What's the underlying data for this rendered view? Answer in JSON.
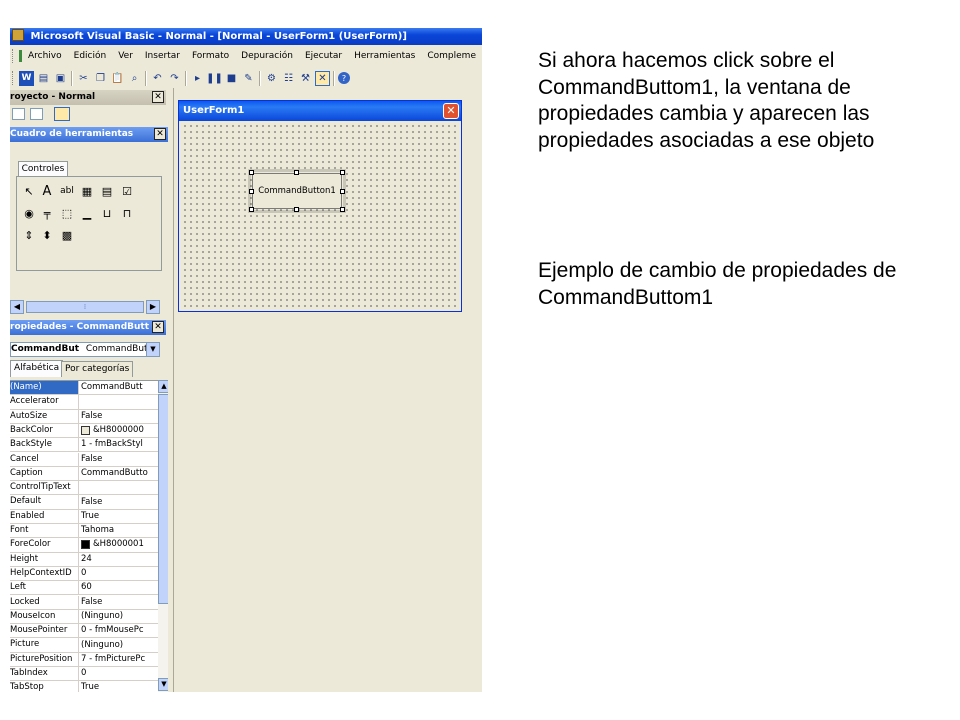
{
  "window": {
    "title": "Microsoft Visual Basic - Normal - [Normal - UserForm1 (UserForm)]"
  },
  "menu": [
    "Archivo",
    "Edición",
    "Ver",
    "Insertar",
    "Formato",
    "Depuración",
    "Ejecutar",
    "Herramientas",
    "Compleme"
  ],
  "project_pane": {
    "title": "royecto - Normal"
  },
  "toolbox": {
    "title": "Cuadro de herramientas",
    "tab": "Controles",
    "label_tool": "A",
    "textbox_tool": "abl"
  },
  "userform": {
    "title": "UserForm1",
    "button_label": "CommandButton1",
    "close_glyph": "✕"
  },
  "properties": {
    "title": "ropiedades - CommandButt",
    "object_name": "CommandBut",
    "object_type": "CommandButto",
    "tabs": [
      "Alfabética",
      "Por categorías"
    ],
    "rows": [
      {
        "name": "(Name)",
        "value": "CommandButt"
      },
      {
        "name": "Accelerator",
        "value": ""
      },
      {
        "name": "AutoSize",
        "value": "False"
      },
      {
        "name": "BackColor",
        "value": "&H8000000",
        "swatch": "#ece9d8"
      },
      {
        "name": "BackStyle",
        "value": "1 - fmBackStyl"
      },
      {
        "name": "Cancel",
        "value": "False"
      },
      {
        "name": "Caption",
        "value": "CommandButto"
      },
      {
        "name": "ControlTipText",
        "value": ""
      },
      {
        "name": "Default",
        "value": "False"
      },
      {
        "name": "Enabled",
        "value": "True"
      },
      {
        "name": "Font",
        "value": "Tahoma"
      },
      {
        "name": "ForeColor",
        "value": "&H8000001",
        "swatch": "#000000"
      },
      {
        "name": "Height",
        "value": "24"
      },
      {
        "name": "HelpContextID",
        "value": "0"
      },
      {
        "name": "Left",
        "value": "60"
      },
      {
        "name": "Locked",
        "value": "False"
      },
      {
        "name": "MouseIcon",
        "value": "(Ninguno)"
      },
      {
        "name": "MousePointer",
        "value": "0 - fmMousePc"
      },
      {
        "name": "Picture",
        "value": "(Ninguno)"
      },
      {
        "name": "PicturePosition",
        "value": "7 - fmPicturePc"
      },
      {
        "name": "TabIndex",
        "value": "0"
      },
      {
        "name": "TabStop",
        "value": "True"
      }
    ]
  },
  "explanation": {
    "p1": "Si ahora hacemos click sobre el CommandButtom1, la ventana de propiedades cambia y aparecen las propiedades asociadas a ese objeto",
    "p2": "Ejemplo de cambio de propiedades de CommandButtom1"
  }
}
